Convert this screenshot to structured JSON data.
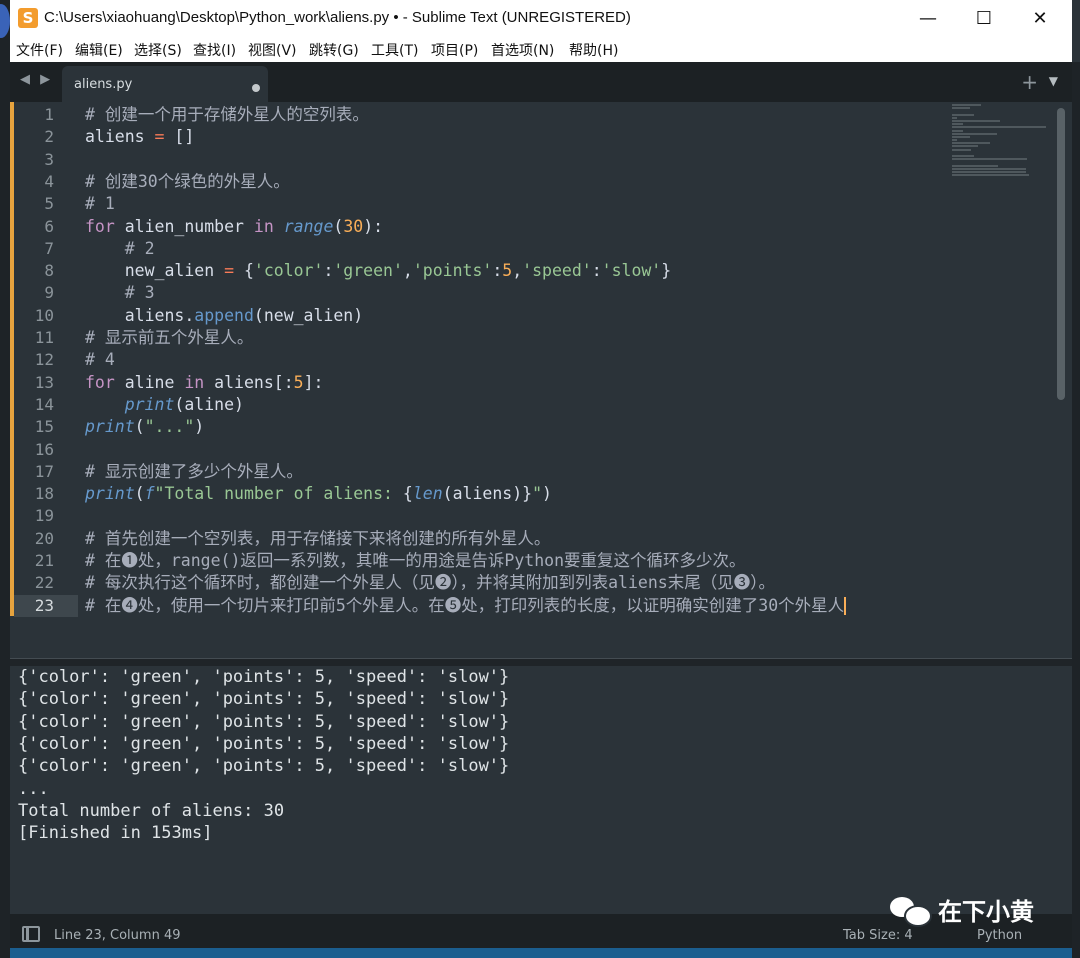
{
  "window": {
    "app_icon_letter": "S",
    "title": "C:\\Users\\xiaohuang\\Desktop\\Python_work\\aliens.py • - Sublime Text (UNREGISTERED)",
    "controls": {
      "minimize": "—",
      "maximize": "☐",
      "close": "✕"
    }
  },
  "menu": [
    "文件(F)",
    "编辑(E)",
    "选择(S)",
    "查找(I)",
    "视图(V)",
    "跳转(G)",
    "工具(T)",
    "项目(P)",
    "首选项(N)",
    "帮助(H)"
  ],
  "tabs": {
    "nav_arrows": "◀ ▶",
    "active_tab": "aliens.py",
    "plus": "+",
    "dropdown": "▼"
  },
  "editor": {
    "current_line": 23,
    "lines": [
      {
        "n": "1",
        "tokens": [
          [
            "cm",
            "# 创建一个用于存储外星人的空列表。"
          ]
        ]
      },
      {
        "n": "2",
        "tokens": [
          [
            "pu",
            "aliens "
          ],
          [
            "op",
            "="
          ],
          [
            "pu",
            " []"
          ]
        ]
      },
      {
        "n": "3",
        "tokens": []
      },
      {
        "n": "4",
        "tokens": [
          [
            "cm",
            "# 创建30个绿色的外星人。"
          ]
        ]
      },
      {
        "n": "5",
        "tokens": [
          [
            "cm",
            "# 1"
          ]
        ]
      },
      {
        "n": "6",
        "tokens": [
          [
            "kw",
            "for"
          ],
          [
            "pu",
            " alien_number "
          ],
          [
            "kw",
            "in"
          ],
          [
            "pu",
            " "
          ],
          [
            "bl",
            "range"
          ],
          [
            "pu",
            "("
          ],
          [
            "nm",
            "30"
          ],
          [
            "pu",
            "):"
          ]
        ]
      },
      {
        "n": "7",
        "tokens": [
          [
            "pu",
            "    "
          ],
          [
            "cm",
            "# 2"
          ]
        ]
      },
      {
        "n": "8",
        "tokens": [
          [
            "pu",
            "    new_alien "
          ],
          [
            "op",
            "="
          ],
          [
            "pu",
            " {"
          ],
          [
            "st",
            "'color'"
          ],
          [
            "pu",
            ":"
          ],
          [
            "st",
            "'green'"
          ],
          [
            "pu",
            ","
          ],
          [
            "st",
            "'points'"
          ],
          [
            "pu",
            ":"
          ],
          [
            "nm",
            "5"
          ],
          [
            "pu",
            ","
          ],
          [
            "st",
            "'speed'"
          ],
          [
            "pu",
            ":"
          ],
          [
            "st",
            "'slow'"
          ],
          [
            "pu",
            "}"
          ]
        ]
      },
      {
        "n": "9",
        "tokens": [
          [
            "pu",
            "    "
          ],
          [
            "cm",
            "# 3"
          ]
        ]
      },
      {
        "n": "10",
        "tokens": [
          [
            "pu",
            "    aliens."
          ],
          [
            "fn",
            "append"
          ],
          [
            "pu",
            "(new_alien)"
          ]
        ]
      },
      {
        "n": "11",
        "tokens": [
          [
            "cm",
            "# 显示前五个外星人。"
          ]
        ]
      },
      {
        "n": "12",
        "tokens": [
          [
            "cm",
            "# 4"
          ]
        ]
      },
      {
        "n": "13",
        "tokens": [
          [
            "kw",
            "for"
          ],
          [
            "pu",
            " aline "
          ],
          [
            "kw",
            "in"
          ],
          [
            "pu",
            " aliens[:"
          ],
          [
            "nm",
            "5"
          ],
          [
            "pu",
            "]:"
          ]
        ]
      },
      {
        "n": "14",
        "tokens": [
          [
            "pu",
            "    "
          ],
          [
            "bl",
            "print"
          ],
          [
            "pu",
            "(aline)"
          ]
        ]
      },
      {
        "n": "15",
        "tokens": [
          [
            "bl",
            "print"
          ],
          [
            "pu",
            "("
          ],
          [
            "st",
            "\"...\""
          ],
          [
            "pu",
            ")"
          ]
        ]
      },
      {
        "n": "16",
        "tokens": []
      },
      {
        "n": "17",
        "tokens": [
          [
            "cm",
            "# 显示创建了多少个外星人。"
          ]
        ]
      },
      {
        "n": "18",
        "tokens": [
          [
            "bl",
            "print"
          ],
          [
            "pu",
            "("
          ],
          [
            "bl",
            "f"
          ],
          [
            "st",
            "\"Total number of aliens: "
          ],
          [
            "pu",
            "{"
          ],
          [
            "bl",
            "len"
          ],
          [
            "pu",
            "(aliens)}"
          ],
          [
            "st",
            "\""
          ],
          [
            "pu",
            ")"
          ]
        ]
      },
      {
        "n": "19",
        "tokens": []
      },
      {
        "n": "20",
        "tokens": [
          [
            "cm",
            "# 首先创建一个空列表，用于存储接下来将创建的所有外星人。"
          ]
        ]
      },
      {
        "n": "21",
        "tokens": [
          [
            "cm",
            "# 在❶处，range()返回一系列数，其唯一的用途是告诉Python要重复这个循环多少次。"
          ]
        ]
      },
      {
        "n": "22",
        "tokens": [
          [
            "cm",
            "# 每次执行这个循环时，都创建一个外星人（见❷），并将其附加到列表aliens末尾（见❸）。"
          ]
        ]
      },
      {
        "n": "23",
        "tokens": [
          [
            "cm",
            "# 在❹处，使用一个切片来打印前5个外星人。在❺处，打印列表的长度，以证明确实创建了30个外星人"
          ]
        ]
      }
    ]
  },
  "output": {
    "lines": [
      "{'color': 'green', 'points': 5, 'speed': 'slow'}",
      "{'color': 'green', 'points': 5, 'speed': 'slow'}",
      "{'color': 'green', 'points': 5, 'speed': 'slow'}",
      "{'color': 'green', 'points': 5, 'speed': 'slow'}",
      "{'color': 'green', 'points': 5, 'speed': 'slow'}",
      "...",
      "Total number of aliens: 30",
      "[Finished in 153ms]"
    ]
  },
  "status": {
    "position": "Line 23, Column 49",
    "tab_size": "Tab Size: 4",
    "syntax": "Python"
  },
  "watermark": {
    "text": "在下小黄"
  },
  "colors": {
    "editor_bg": "#2b3339",
    "comment": "#a7adba",
    "keyword": "#c594c5",
    "operator": "#f97b58",
    "builtin": "#6699cc",
    "number": "#f9ae58",
    "string": "#99c794",
    "modified_marker": "#e6a33e"
  }
}
